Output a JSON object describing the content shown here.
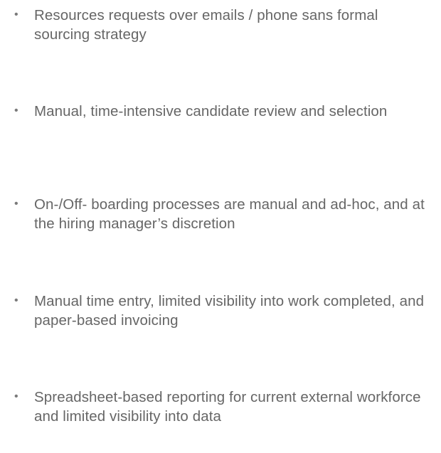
{
  "bullets": [
    {
      "marker": "•",
      "text": "Resources requests over emails / phone sans formal sourcing strategy"
    },
    {
      "marker": "•",
      "text": "Manual, time-intensive candidate review and selection"
    },
    {
      "marker": "•",
      "text": "On-/Off- boarding processes are manual and ad-hoc, and at the hiring manager’s discretion"
    },
    {
      "marker": "•",
      "text": "Manual time entry, limited visibility into work completed, and paper-based invoicing"
    },
    {
      "marker": "•",
      "text": "Spreadsheet-based reporting for current external workforce and limited visibility into data"
    }
  ]
}
